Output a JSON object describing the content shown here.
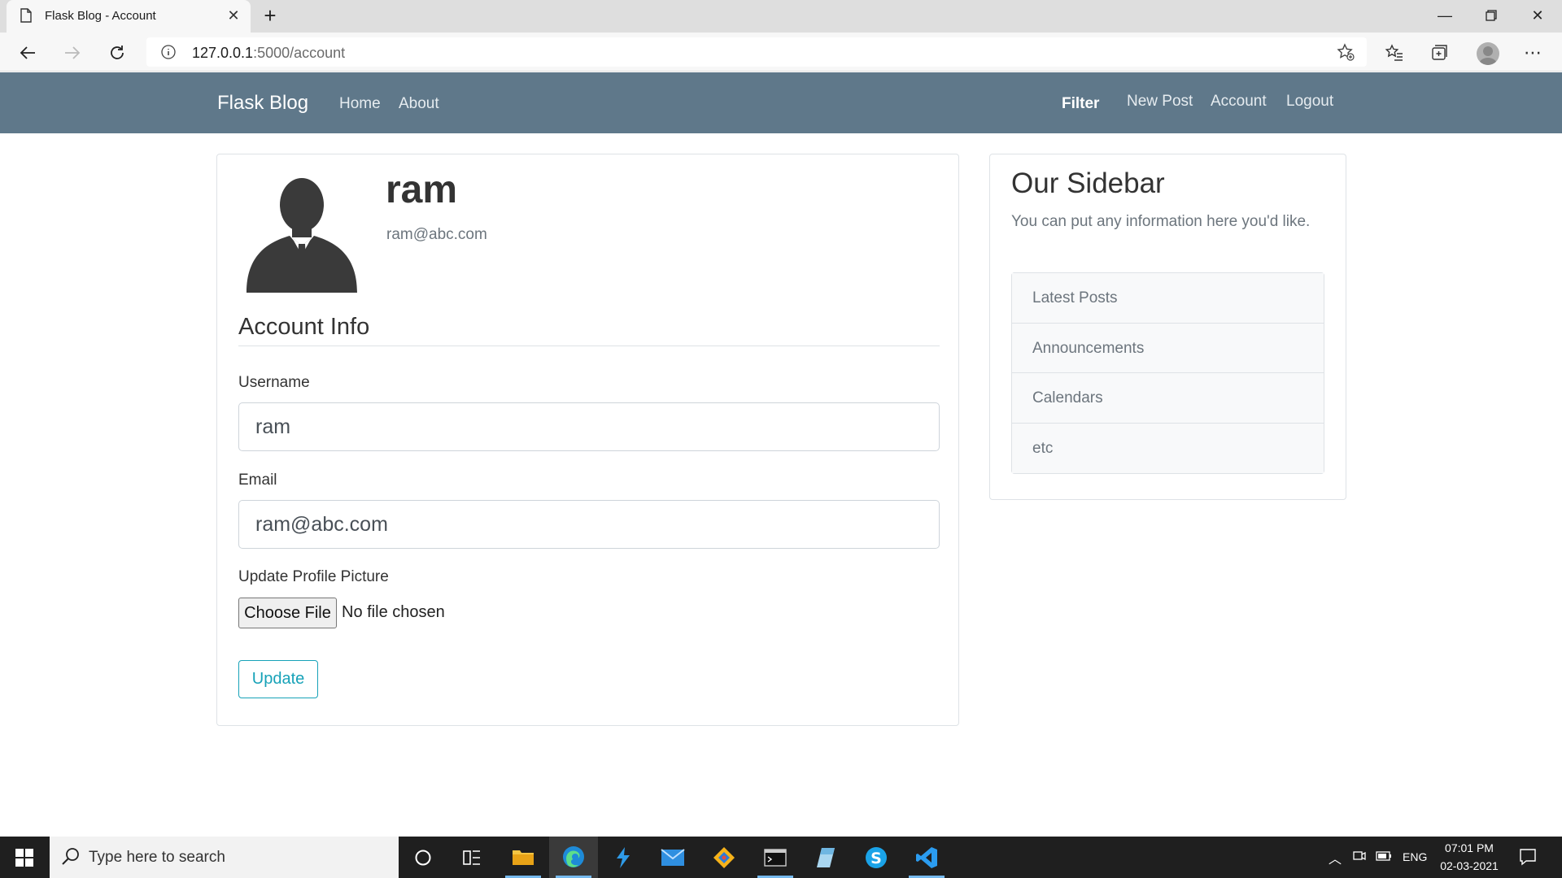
{
  "browser": {
    "tab_title": "Flask Blog - Account",
    "url_host": "127.0.0.1",
    "url_path": ":5000/account"
  },
  "navbar": {
    "brand": "Flask Blog",
    "left_links": [
      "Home",
      "About"
    ],
    "filter": "Filter",
    "right_links": [
      "New Post",
      "Account",
      "Logout"
    ]
  },
  "account": {
    "name": "ram",
    "email": "ram@abc.com",
    "legend": "Account Info",
    "username_label": "Username",
    "username_value": "ram",
    "email_label": "Email",
    "email_value": "ram@abc.com",
    "picture_label": "Update Profile Picture",
    "choose_file": "Choose File",
    "no_file": "No file chosen",
    "update_button": "Update"
  },
  "sidebar": {
    "title": "Our Sidebar",
    "text": "You can put any information here you'd like.",
    "items": [
      "Latest Posts",
      "Announcements",
      "Calendars",
      "etc"
    ]
  },
  "taskbar": {
    "search_placeholder": "Type here to search",
    "language": "ENG",
    "time": "07:01 PM",
    "date": "02-03-2021"
  },
  "colors": {
    "navbar": "#5f788a",
    "update_accent": "#17a2b8"
  }
}
